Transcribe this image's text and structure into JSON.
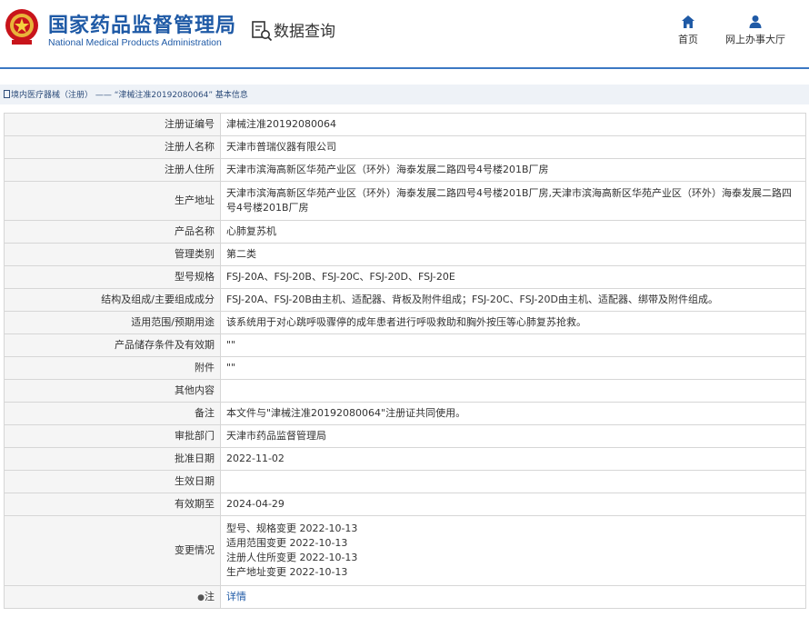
{
  "header": {
    "title_cn": "国家药品监督管理局",
    "title_en": "National Medical Products Administration",
    "query_title": "数据查询",
    "nav": [
      {
        "label": "首页",
        "icon": "home-icon"
      },
      {
        "label": "网上办事大厅",
        "icon": "user-icon"
      }
    ]
  },
  "breadcrumb": {
    "section": "境内医疗器械（注册）",
    "separator": " —— ",
    "current": "“津械注准20192080064” 基本信息"
  },
  "details": [
    {
      "label": "注册证编号",
      "value": "津械注准20192080064"
    },
    {
      "label": "注册人名称",
      "value": "天津市普瑞仪器有限公司"
    },
    {
      "label": "注册人住所",
      "value": "天津市滨海高新区华苑产业区（环外）海泰发展二路四号4号楼201B厂房"
    },
    {
      "label": "生产地址",
      "value": "天津市滨海高新区华苑产业区（环外）海泰发展二路四号4号楼201B厂房,天津市滨海高新区华苑产业区（环外）海泰发展二路四号4号楼201B厂房"
    },
    {
      "label": "产品名称",
      "value": "心肺复苏机"
    },
    {
      "label": "管理类别",
      "value": "第二类"
    },
    {
      "label": "型号规格",
      "value": "FSJ-20A、FSJ-20B、FSJ-20C、FSJ-20D、FSJ-20E"
    },
    {
      "label": "结构及组成/主要组成成分",
      "value": "FSJ-20A、FSJ-20B由主机、适配器、背板及附件组成；FSJ-20C、FSJ-20D由主机、适配器、绑带及附件组成。"
    },
    {
      "label": "适用范围/预期用途",
      "value": "该系统用于对心跳呼吸骤停的成年患者进行呼吸救助和胸外按压等心肺复苏抢救。"
    },
    {
      "label": "产品储存条件及有效期",
      "value": "\"\""
    },
    {
      "label": "附件",
      "value": "\"\""
    },
    {
      "label": "其他内容",
      "value": ""
    },
    {
      "label": "备注",
      "value": "本文件与\"津械注准20192080064\"注册证共同使用。"
    },
    {
      "label": "审批部门",
      "value": "天津市药品监督管理局"
    },
    {
      "label": "批准日期",
      "value": "2022-11-02"
    },
    {
      "label": "生效日期",
      "value": ""
    },
    {
      "label": "有效期至",
      "value": "2024-04-29"
    }
  ],
  "changes": {
    "label": "变更情况",
    "items": [
      "型号、规格变更 2022-10-13",
      "适用范围变更 2022-10-13",
      "注册人住所变更 2022-10-13",
      "生产地址变更 2022-10-13"
    ]
  },
  "note": {
    "label": "注",
    "link": "详情"
  },
  "colors": {
    "brand": "#1f5aa6",
    "accent_rule": "#3b78c3",
    "label_bg": "#f5f5f5",
    "border": "#d6d6d6"
  }
}
